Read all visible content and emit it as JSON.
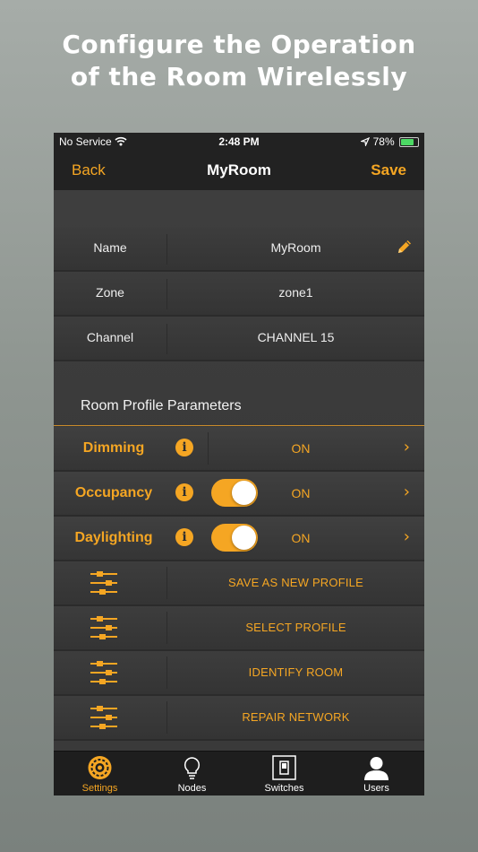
{
  "promo": {
    "headline_line1": "Configure the Operation",
    "headline_line2": "of the Room Wirelessly"
  },
  "status_bar": {
    "carrier": "No Service",
    "time": "2:48 PM",
    "battery": "78%",
    "battery_level": 0.78
  },
  "nav": {
    "back_label": "Back",
    "title": "MyRoom",
    "save_label": "Save"
  },
  "fields": [
    {
      "label": "Name",
      "value": "MyRoom"
    },
    {
      "label": "Zone",
      "value": "zone1"
    },
    {
      "label": "Channel",
      "value": "CHANNEL 15"
    }
  ],
  "section": {
    "title": "Room Profile Parameters"
  },
  "params": [
    {
      "label": "Dimming",
      "value": "ON",
      "has_toggle": false
    },
    {
      "label": "Occupancy",
      "value": "ON",
      "has_toggle": true,
      "toggle_on": true
    },
    {
      "label": "Daylighting",
      "value": "ON",
      "has_toggle": true,
      "toggle_on": true
    }
  ],
  "actions": [
    {
      "label": "SAVE AS NEW PROFILE"
    },
    {
      "label": "SELECT PROFILE"
    },
    {
      "label": "IDENTIFY ROOM"
    },
    {
      "label": "REPAIR NETWORK"
    }
  ],
  "tabs": [
    {
      "label": "Settings",
      "icon": "settings-gear-icon",
      "active": true
    },
    {
      "label": "Nodes",
      "icon": "lightbulb-icon",
      "active": false
    },
    {
      "label": "Switches",
      "icon": "switch-icon",
      "active": false
    },
    {
      "label": "Users",
      "icon": "user-icon",
      "active": false
    }
  ],
  "colors": {
    "accent": "#f5a623",
    "background": "#3a3a3a",
    "bar": "#222222"
  }
}
